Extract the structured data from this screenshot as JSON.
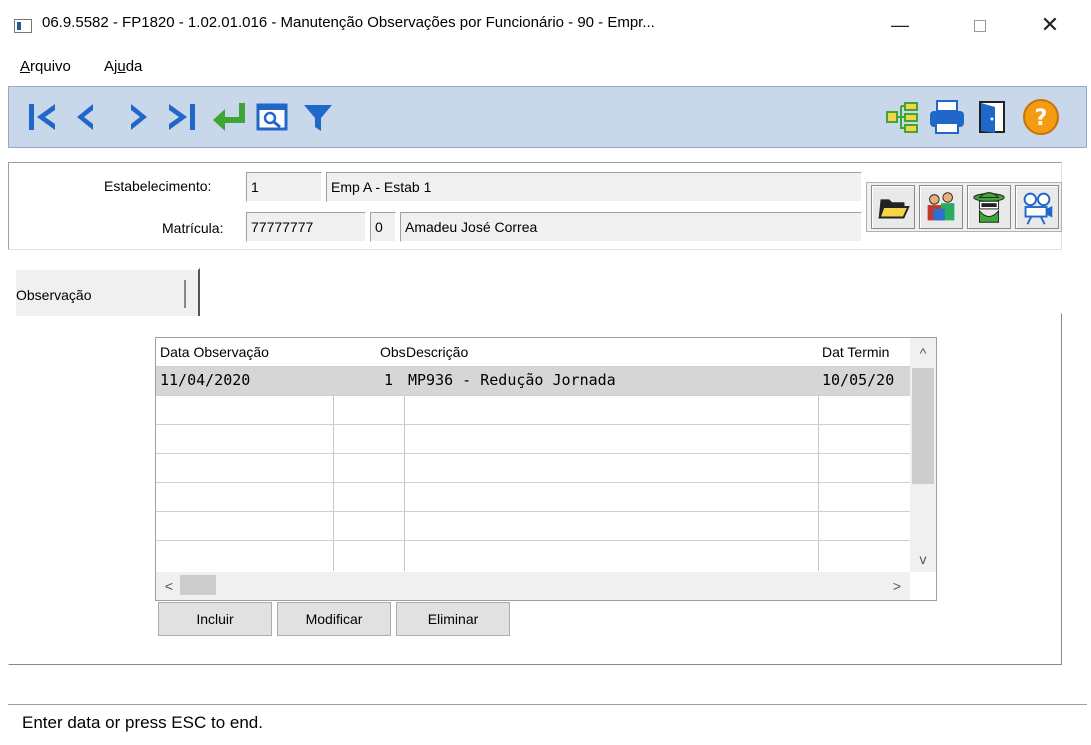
{
  "window": {
    "title": "06.9.5582 - FP1820 - 1.02.01.016 - Manutenção Observações por Funcionário - 90 - Empr...",
    "minimize_symbol": "—",
    "close_symbol": "✕"
  },
  "menu": {
    "items": [
      {
        "mnemonic": "A",
        "rest": "rquivo"
      },
      {
        "pre": "Aj",
        "mnemonic": "u",
        "rest": "da"
      }
    ]
  },
  "toolbar": {
    "icons": [
      "first-record-icon",
      "previous-record-icon",
      "next-record-icon",
      "last-record-icon",
      "go-to-icon",
      "search-icon",
      "filter-icon",
      "tree-icon",
      "print-icon",
      "exit-door-icon",
      "help-icon"
    ],
    "colors": {
      "nav": "#1f68c9",
      "enter": "#3fa535",
      "help": "#f39c12",
      "background": "#c8d8ea"
    }
  },
  "header": {
    "estabelecimento_label": "Estabelecimento:",
    "estabelecimento_code": "1",
    "estabelecimento_name": "Emp A - Estab 1",
    "matricula_label": "Matrícula:",
    "matricula_value": "77777777",
    "matricula_digit": "0",
    "funcionario_name": "Amadeu José Correa",
    "buttons": [
      "open-folder-icon",
      "people-icon",
      "spy-icon",
      "projector-icon"
    ]
  },
  "tab": {
    "label": "Observação"
  },
  "grid": {
    "columns": [
      "Data Observação",
      "Obs",
      "Descrição",
      "Dat Termin"
    ],
    "rows": [
      {
        "data": "11/04/2020",
        "obs": "1",
        "descricao": "MP936 - Redução Jornada",
        "termino": "10/05/20"
      }
    ],
    "scroll_up": "^",
    "scroll_down": "v",
    "scroll_left": "<",
    "scroll_right": ">"
  },
  "actions": {
    "incluir": "Incluir",
    "modificar": "Modificar",
    "eliminar": "Eliminar"
  },
  "status": {
    "text": "Enter data or press ESC to end."
  }
}
